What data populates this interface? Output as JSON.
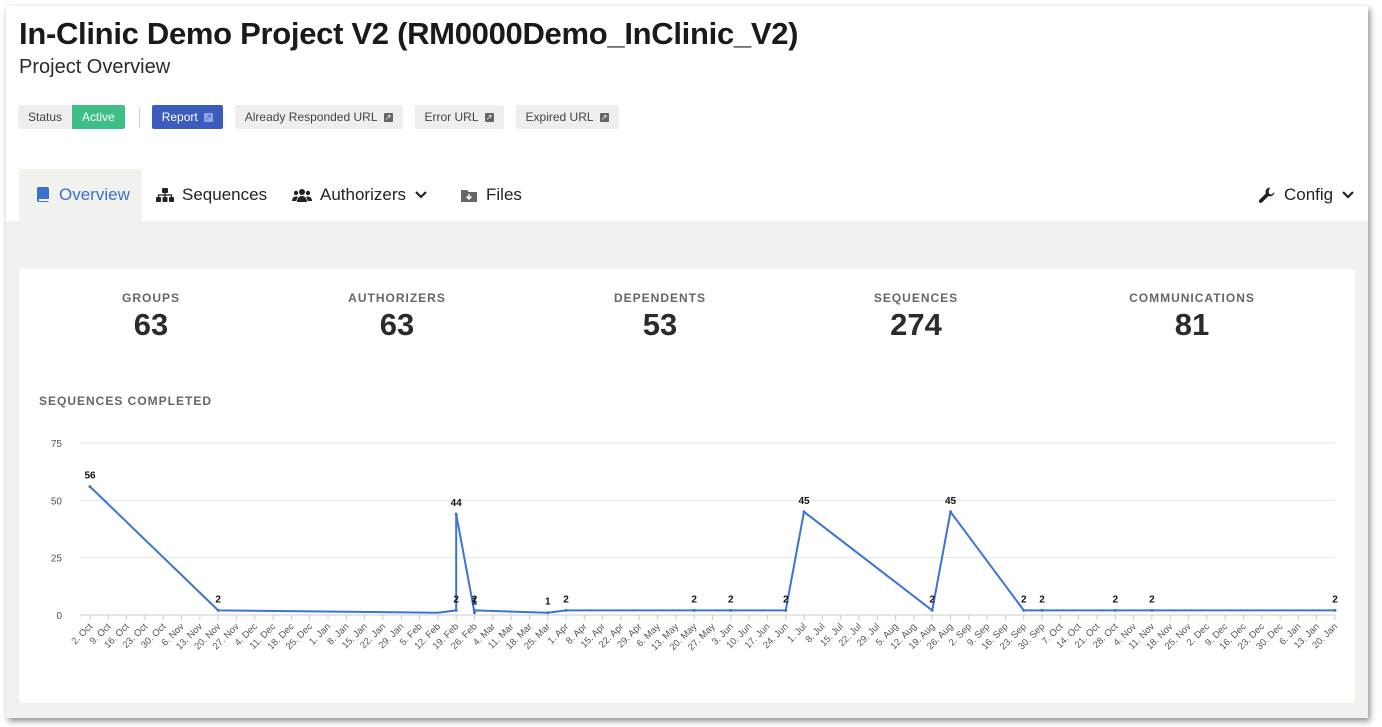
{
  "header": {
    "title": "In-Clinic Demo Project V2 (RM0000Demo_InClinic_V2)",
    "subtitle": "Project Overview"
  },
  "chips": {
    "status_label": "Status",
    "status_value": "Active",
    "status_color": "#3fbf88",
    "report": "Report",
    "report_color": "#3b5bbd",
    "already_responded": "Already Responded URL",
    "error_url": "Error URL",
    "expired_url": "Expired URL"
  },
  "tabs": {
    "overview": "Overview",
    "sequences": "Sequences",
    "authorizers": "Authorizers",
    "files": "Files",
    "config": "Config",
    "active_color": "#3d6fce"
  },
  "stats": [
    {
      "label": "GROUPS",
      "value": "63"
    },
    {
      "label": "AUTHORIZERS",
      "value": "63"
    },
    {
      "label": "DEPENDENTS",
      "value": "53"
    },
    {
      "label": "SEQUENCES",
      "value": "274"
    },
    {
      "label": "COMMUNICATIONS",
      "value": "81"
    }
  ],
  "chart_title": "SEQUENCES COMPLETED",
  "chart_data": {
    "type": "line",
    "title": "SEQUENCES COMPLETED",
    "xlabel": "",
    "ylabel": "",
    "ylim": [
      0,
      75
    ],
    "yticks": [
      0,
      25,
      50,
      75
    ],
    "grid": true,
    "color": "#3a74d4",
    "x_categories": [
      "2. Oct",
      "9. Oct",
      "16. Oct",
      "23. Oct",
      "30. Oct",
      "6. Nov",
      "13. Nov",
      "20. Nov",
      "27. Nov",
      "4. Dec",
      "11. Dec",
      "18. Dec",
      "25. Dec",
      "1. Jan",
      "8. Jan",
      "15. Jan",
      "22. Jan",
      "29. Jan",
      "5. Feb",
      "12. Feb",
      "19. Feb",
      "26. Feb",
      "4. Mar",
      "11. Mar",
      "18. Mar",
      "25. Mar",
      "1. Apr",
      "8. Apr",
      "15. Apr",
      "22. Apr",
      "29. Apr",
      "6. May",
      "13. May",
      "20. May",
      "27. May",
      "3. Jun",
      "10. Jun",
      "17. Jun",
      "24. Jun",
      "1. Jul",
      "8. Jul",
      "15. Jul",
      "22. Jul",
      "29. Jul",
      "5. Aug",
      "12. Aug",
      "19. Aug",
      "26. Aug",
      "2. Sep",
      "9. Sep",
      "16. Sep",
      "23. Sep",
      "30. Sep",
      "7. Oct",
      "14. Oct",
      "21. Oct",
      "28. Oct",
      "4. Nov",
      "11. Nov",
      "18. Nov",
      "25. Nov",
      "2. Dec",
      "9. Dec",
      "16. Dec",
      "23. Dec",
      "30. Dec",
      "6. Jan",
      "13. Jan",
      "20. Jan"
    ],
    "points": [
      {
        "x": "2. Oct",
        "y": 56,
        "label": "56"
      },
      {
        "x": "20. Nov",
        "y": 2,
        "label": "2"
      },
      {
        "x": "12. Feb",
        "y": 1
      },
      {
        "x": "19. Feb",
        "y": 2,
        "label": "2"
      },
      {
        "x": "19. Feb",
        "y": 44,
        "label": "44"
      },
      {
        "x": "26. Feb",
        "y": 1,
        "label": "1"
      },
      {
        "x": "26. Feb",
        "y": 2,
        "label": "2"
      },
      {
        "x": "25. Mar",
        "y": 1,
        "label": "1"
      },
      {
        "x": "1. Apr",
        "y": 2,
        "label": "2"
      },
      {
        "x": "20. May",
        "y": 2,
        "label": "2"
      },
      {
        "x": "3. Jun",
        "y": 2,
        "label": "2"
      },
      {
        "x": "24. Jun",
        "y": 2,
        "label": "2"
      },
      {
        "x": "1. Jul",
        "y": 45,
        "label": "45"
      },
      {
        "x": "19. Aug",
        "y": 2,
        "label": "2"
      },
      {
        "x": "26. Aug",
        "y": 45,
        "label": "45"
      },
      {
        "x": "23. Sep",
        "y": 2,
        "label": "2"
      },
      {
        "x": "30. Sep",
        "y": 2,
        "label": "2"
      },
      {
        "x": "28. Oct",
        "y": 2,
        "label": "2"
      },
      {
        "x": "11. Nov",
        "y": 2,
        "label": "2"
      },
      {
        "x": "20. Jan",
        "y": 2,
        "label": "2"
      }
    ]
  }
}
